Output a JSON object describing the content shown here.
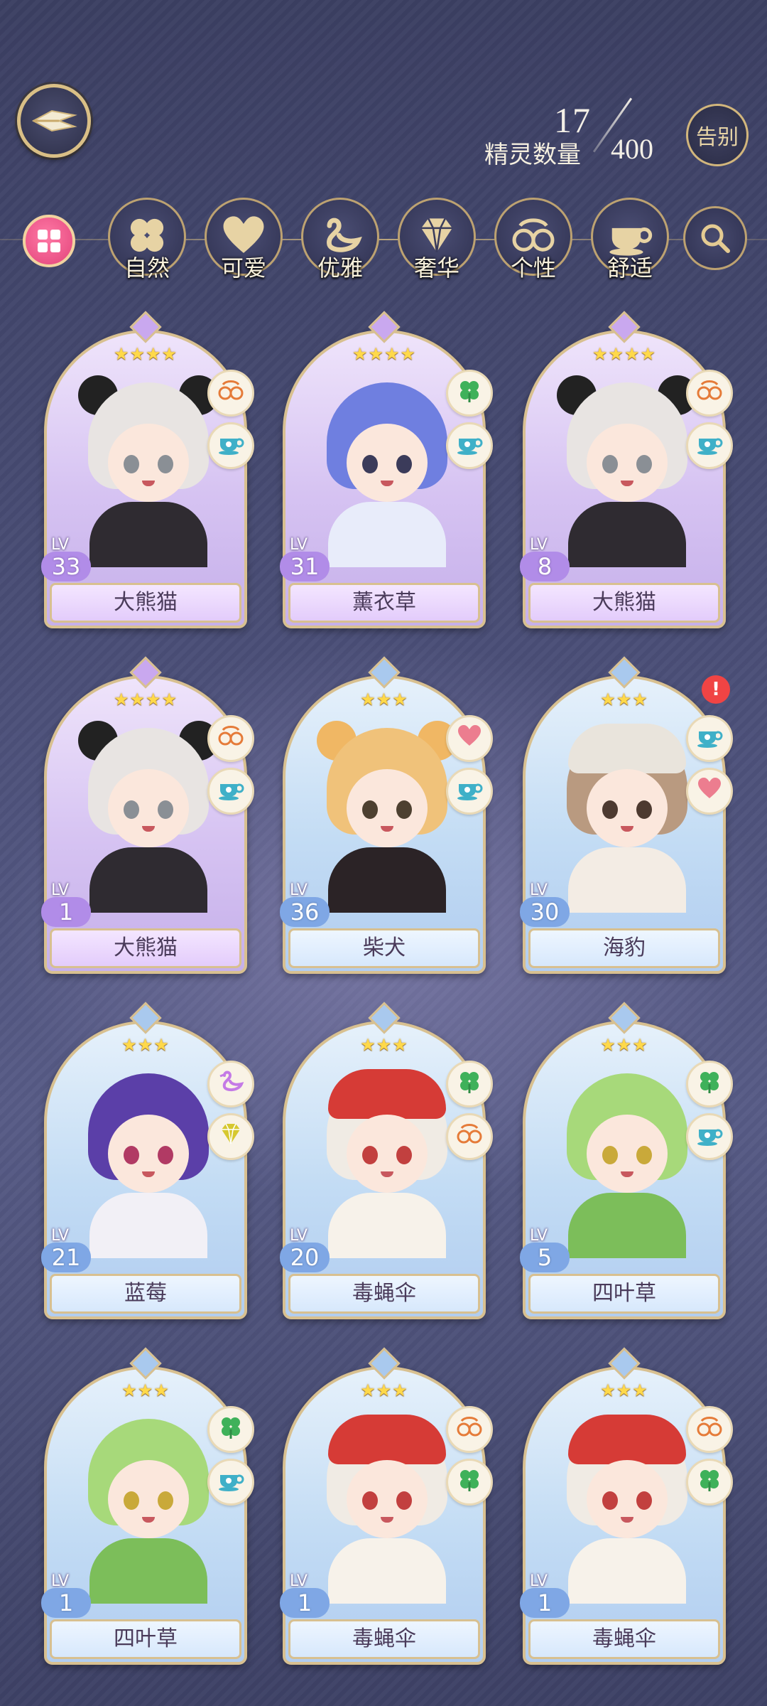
{
  "header": {
    "count_current": "17",
    "count_label": "精灵数量",
    "count_max": "400",
    "farewell_label": "告别"
  },
  "filters": [
    {
      "name": "nature",
      "label": "自然",
      "icon": "clover-icon"
    },
    {
      "name": "cute",
      "label": "可爱",
      "icon": "heart-icon"
    },
    {
      "name": "elegant",
      "label": "优雅",
      "icon": "swan-icon"
    },
    {
      "name": "luxury",
      "label": "奢华",
      "icon": "diamond-icon"
    },
    {
      "name": "personality",
      "label": "个性",
      "icon": "glasses-icon"
    },
    {
      "name": "comfort",
      "label": "舒适",
      "icon": "teacup-icon"
    }
  ],
  "cards": [
    {
      "name": "大熊猫",
      "level": "33",
      "lv_tag": "LV",
      "stars": "★★★★",
      "rarity": "purple",
      "attrs": [
        "glasses-icon",
        "teacup-icon"
      ],
      "alert": false
    },
    {
      "name": "薰衣草",
      "level": "31",
      "lv_tag": "LV",
      "stars": "★★★★",
      "rarity": "purple",
      "attrs": [
        "clover-icon",
        "teacup-icon"
      ],
      "alert": false
    },
    {
      "name": "大熊猫",
      "level": "8",
      "lv_tag": "LV",
      "stars": "★★★★",
      "rarity": "purple",
      "attrs": [
        "glasses-icon",
        "teacup-icon"
      ],
      "alert": false
    },
    {
      "name": "大熊猫",
      "level": "1",
      "lv_tag": "LV",
      "stars": "★★★★",
      "rarity": "purple",
      "attrs": [
        "glasses-icon",
        "teacup-icon"
      ],
      "alert": false
    },
    {
      "name": "柴犬",
      "level": "36",
      "lv_tag": "LV",
      "stars": "★★★",
      "rarity": "blue",
      "attrs": [
        "heart-icon",
        "teacup-icon"
      ],
      "alert": false
    },
    {
      "name": "海豹",
      "level": "30",
      "lv_tag": "LV",
      "stars": "★★★",
      "rarity": "blue",
      "attrs": [
        "teacup-icon",
        "heart-icon"
      ],
      "alert": true
    },
    {
      "name": "蓝莓",
      "level": "21",
      "lv_tag": "LV",
      "stars": "★★★",
      "rarity": "blue",
      "attrs": [
        "swan-icon",
        "diamond-icon"
      ],
      "alert": false
    },
    {
      "name": "毒蝇伞",
      "level": "20",
      "lv_tag": "LV",
      "stars": "★★★",
      "rarity": "blue",
      "attrs": [
        "clover-icon",
        "glasses-icon"
      ],
      "alert": false
    },
    {
      "name": "四叶草",
      "level": "5",
      "lv_tag": "LV",
      "stars": "★★★",
      "rarity": "blue",
      "attrs": [
        "clover-icon",
        "teacup-icon"
      ],
      "alert": false
    },
    {
      "name": "四叶草",
      "level": "1",
      "lv_tag": "LV",
      "stars": "★★★",
      "rarity": "blue",
      "attrs": [
        "clover-icon",
        "teacup-icon"
      ],
      "alert": false
    },
    {
      "name": "毒蝇伞",
      "level": "1",
      "lv_tag": "LV",
      "stars": "★★★",
      "rarity": "blue",
      "attrs": [
        "glasses-icon",
        "clover-icon"
      ],
      "alert": false
    },
    {
      "name": "毒蝇伞",
      "level": "1",
      "lv_tag": "LV",
      "stars": "★★★",
      "rarity": "blue",
      "attrs": [
        "glasses-icon",
        "clover-icon"
      ],
      "alert": false
    }
  ],
  "colors": {
    "accent_gold": "#d8c090",
    "purple_card": "#d6c3f2",
    "blue_card": "#c3dcf4",
    "alert_red": "#f04444"
  }
}
